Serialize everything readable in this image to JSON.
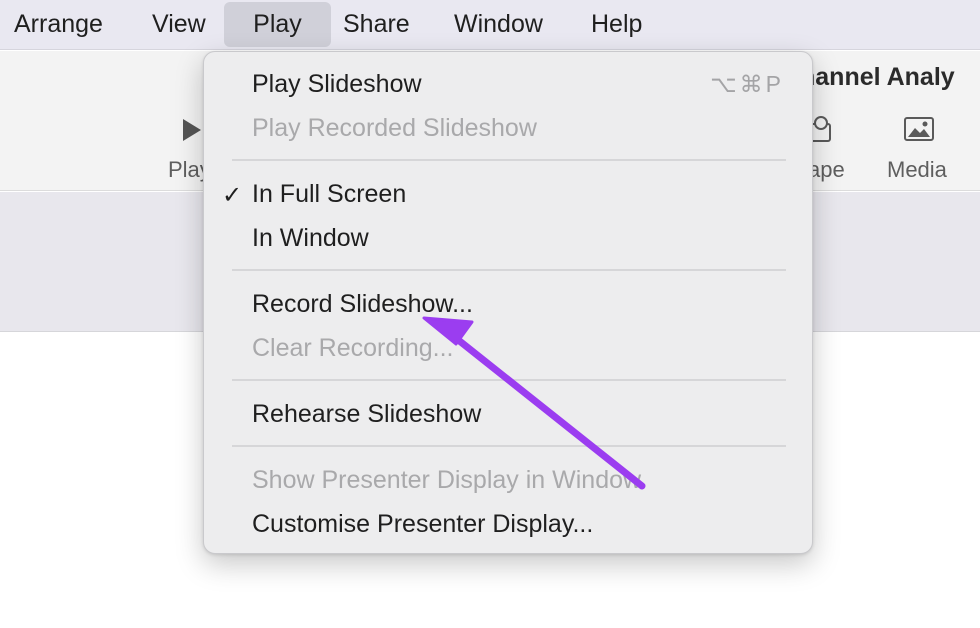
{
  "menubar": {
    "items": [
      "Arrange",
      "View",
      "Play",
      "Share",
      "Window",
      "Help"
    ],
    "active": "Play"
  },
  "toolbar": {
    "doc_title": "hannel Analy",
    "play_label": "Play",
    "shape_label": "ape",
    "media_label": "Media",
    "icons": {
      "play": "play-icon",
      "shape": "shape-icon",
      "media": "media-icon"
    }
  },
  "play_menu": {
    "play_slideshow": {
      "label": "Play Slideshow",
      "shortcut": "⌥⌘P"
    },
    "play_recorded": {
      "label": "Play Recorded Slideshow",
      "enabled": false
    },
    "in_full_screen": {
      "label": "In Full Screen",
      "checked": true,
      "check_mark": "✓"
    },
    "in_window": {
      "label": "In Window"
    },
    "record_slideshow": {
      "label": "Record Slideshow..."
    },
    "clear_recording": {
      "label": "Clear Recording...",
      "enabled": false
    },
    "rehearse_slideshow": {
      "label": "Rehearse Slideshow"
    },
    "show_presenter_display": {
      "label": "Show Presenter Display in Window",
      "enabled": false
    },
    "customise_presenter_display": {
      "label": "Customise Presenter Display..."
    }
  },
  "colors": {
    "annotation_arrow": "#9b3df0",
    "menubar_bg": "#e9e8f1",
    "menu_bg": "#ededee",
    "disabled_text": "#a9a9ab"
  }
}
